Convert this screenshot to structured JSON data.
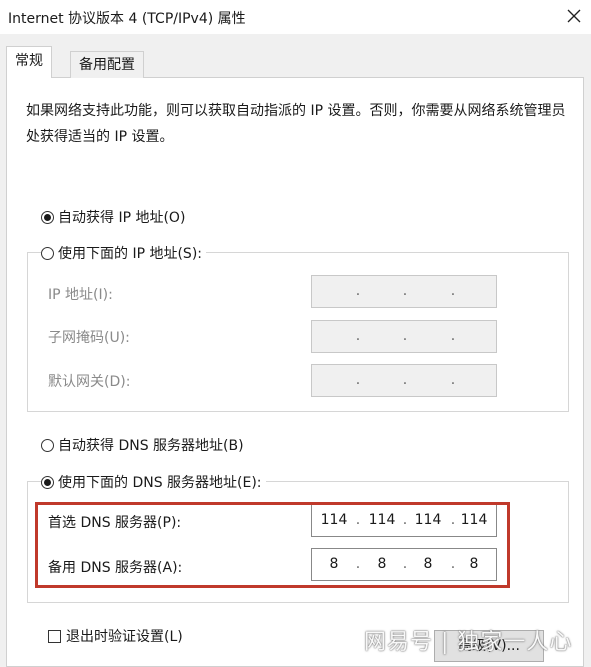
{
  "window": {
    "title": "Internet 协议版本 4 (TCP/IPv4) 属性"
  },
  "tabs": [
    {
      "label": "常规",
      "active": true
    },
    {
      "label": "备用配置",
      "active": false
    }
  ],
  "intro_text": "如果网络支持此功能，则可以获取自动指派的 IP 设置。否则，你需要从网络系统管理员处获得适当的 IP 设置。",
  "ip_section": {
    "auto_radio": {
      "label": "自动获得 IP 地址(O)",
      "checked": true
    },
    "manual_radio": {
      "label": "使用下面的 IP 地址(S):",
      "checked": false
    },
    "fields": [
      {
        "label": "IP 地址(I):",
        "octets": [
          "",
          "",
          "",
          ""
        ]
      },
      {
        "label": "子网掩码(U):",
        "octets": [
          "",
          "",
          "",
          ""
        ]
      },
      {
        "label": "默认网关(D):",
        "octets": [
          "",
          "",
          "",
          ""
        ]
      }
    ]
  },
  "dns_section": {
    "auto_radio": {
      "label": "自动获得 DNS 服务器地址(B)",
      "checked": false
    },
    "manual_radio": {
      "label": "使用下面的 DNS 服务器地址(E):",
      "checked": true
    },
    "preferred": {
      "label": "首选 DNS 服务器(P):",
      "octets": [
        "114",
        "114",
        "114",
        "114"
      ]
    },
    "alternate": {
      "label": "备用 DNS 服务器(A):",
      "octets": [
        "8",
        "8",
        "8",
        "8"
      ]
    }
  },
  "validate_checkbox": {
    "label": "退出时验证设置(L)",
    "checked": false
  },
  "advanced_button": {
    "label": "高级(V)..."
  },
  "watermark": "网易号 | 独家一人心",
  "colors": {
    "highlight_border": "#c0392b",
    "dialog_bg": "#f0f0f0"
  }
}
